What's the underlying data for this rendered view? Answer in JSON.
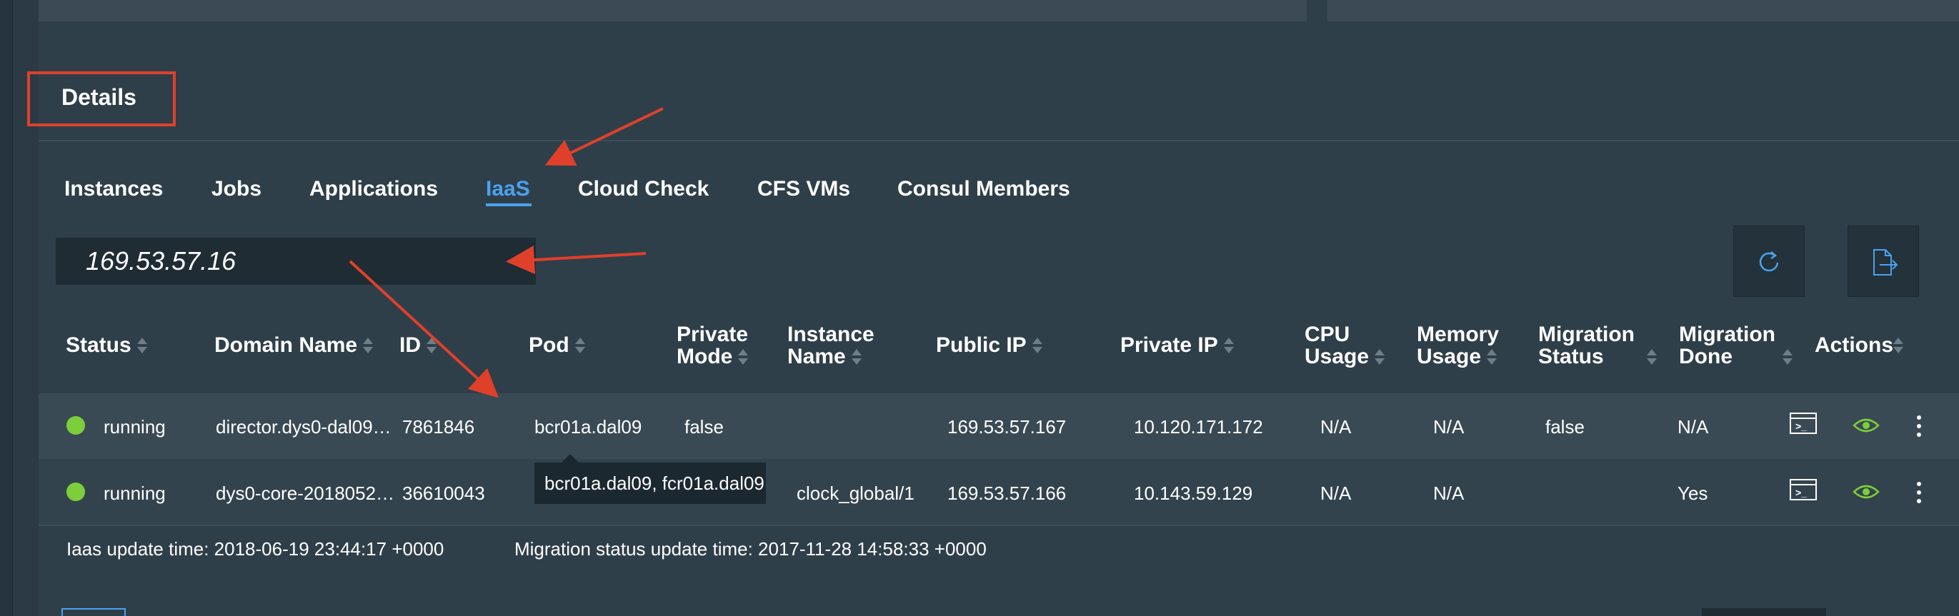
{
  "details": {
    "title": "Details"
  },
  "tabs": [
    {
      "label": "Instances"
    },
    {
      "label": "Jobs"
    },
    {
      "label": "Applications"
    },
    {
      "label": "IaaS",
      "active": true
    },
    {
      "label": "Cloud Check"
    },
    {
      "label": "CFS VMs"
    },
    {
      "label": "Consul Members"
    }
  ],
  "search": {
    "value": "169.53.57.16"
  },
  "toolbar": {
    "refresh_icon": "refresh-icon",
    "export_icon": "export-file-icon"
  },
  "table": {
    "headers": {
      "status": "Status",
      "domain": "Domain Name",
      "id": "ID",
      "pod": "Pod",
      "private_mode_1": "Private",
      "private_mode_2": "Mode",
      "instance_name_1": "Instance",
      "instance_name_2": "Name",
      "public_ip": "Public IP",
      "private_ip": "Private IP",
      "cpu_1": "CPU",
      "cpu_2": "Usage",
      "memory_1": "Memory",
      "memory_2": "Usage",
      "migration_status_1": "Migration",
      "migration_status_2": "Status",
      "migration_done_1": "Migration",
      "migration_done_2": "Done",
      "actions": "Actions"
    },
    "rows": [
      {
        "status": "running",
        "domain": "director.dys0-dal09…",
        "id": "7861846",
        "pod": "bcr01a.dal09",
        "private_mode": "false",
        "instance_name": "",
        "public_ip": "169.53.57.167",
        "private_ip": "10.120.171.172",
        "cpu": "N/A",
        "memory": "N/A",
        "migration_status": "false",
        "migration_done": "N/A"
      },
      {
        "status": "running",
        "domain": "dys0-core-2018052…",
        "id": "36610043",
        "pod": "",
        "private_mode": "",
        "instance_name": "clock_global/1",
        "public_ip": "169.53.57.166",
        "private_ip": "10.143.59.129",
        "cpu": "N/A",
        "memory": "N/A",
        "migration_status": "",
        "migration_done": "Yes"
      }
    ],
    "tooltip": "bcr01a.dal09, fcr01a.dal09"
  },
  "footer": {
    "iaas_update": "Iaas update time: 2018-06-19 23:44:17 +0000",
    "migration_update": "Migration status update time: 2017-11-28 14:58:33 +0000"
  },
  "colors": {
    "accent": "#4aa2f0",
    "status_running": "#7ccf3a",
    "annotation": "#e0402a",
    "eye_icon": "#7ccf3a"
  }
}
